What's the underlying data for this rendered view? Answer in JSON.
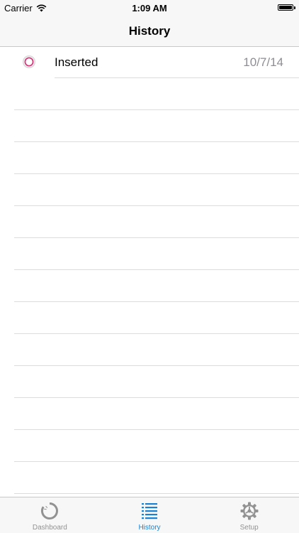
{
  "status_bar": {
    "carrier": "Carrier",
    "time": "1:09 AM"
  },
  "nav": {
    "title": "History"
  },
  "history": {
    "entries": [
      {
        "title": "Inserted",
        "date": "10/7/14",
        "icon": "ring-status-icon",
        "icon_color": "#d63a78"
      }
    ]
  },
  "tabbar": {
    "accent_color": "#1a82d0",
    "items": [
      {
        "label": "Dashboard",
        "icon": "progress-ring-icon",
        "selected": false
      },
      {
        "label": "History",
        "icon": "list-icon",
        "selected": true
      },
      {
        "label": "Setup",
        "icon": "gear-icon",
        "selected": false
      }
    ]
  }
}
